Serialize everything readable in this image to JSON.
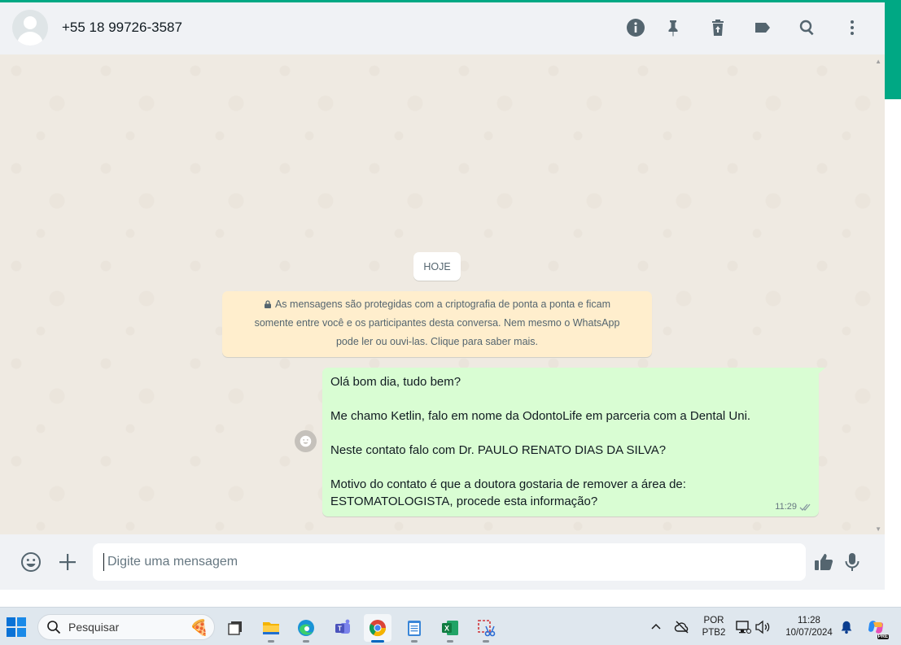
{
  "header": {
    "contact_name": "+55 18 99726-3587"
  },
  "chat": {
    "day_label": "HOJE",
    "encryption_notice": {
      "line1": "As mensagens são protegidas com a criptografia de ponta a ponta e ficam",
      "line2": "somente entre você e os participantes desta conversa. Nem mesmo o WhatsApp",
      "line3": "pode ler ou ouvi-las. Clique para saber mais."
    },
    "message": {
      "lines": [
        "Olá bom dia, tudo bem?",
        "",
        "Me chamo Ketlin, falo em nome da OdontoLife em parceria com a Dental Uni.",
        "",
        "Neste contato falo com Dr. PAULO RENATO DIAS DA SILVA?",
        "",
        "Motivo do contato é que a doutora gostaria de remover a área de:",
        "ESTOMATOLOGISTA, procede esta informação?"
      ],
      "time": "11:29",
      "status": "delivered"
    }
  },
  "composer": {
    "placeholder": "Digite uma mensagem"
  },
  "taskbar": {
    "search_label": "Pesquisar",
    "language_line1": "POR",
    "language_line2": "PTB2",
    "time": "11:28",
    "date": "10/07/2024",
    "copilot_badge": "PRE"
  },
  "colors": {
    "accent": "#00a884",
    "outgoing_bubble": "#d9fdd3",
    "notice_bg": "#ffeecd",
    "chat_bg": "#efeae2",
    "header_bg": "#f0f2f5"
  }
}
